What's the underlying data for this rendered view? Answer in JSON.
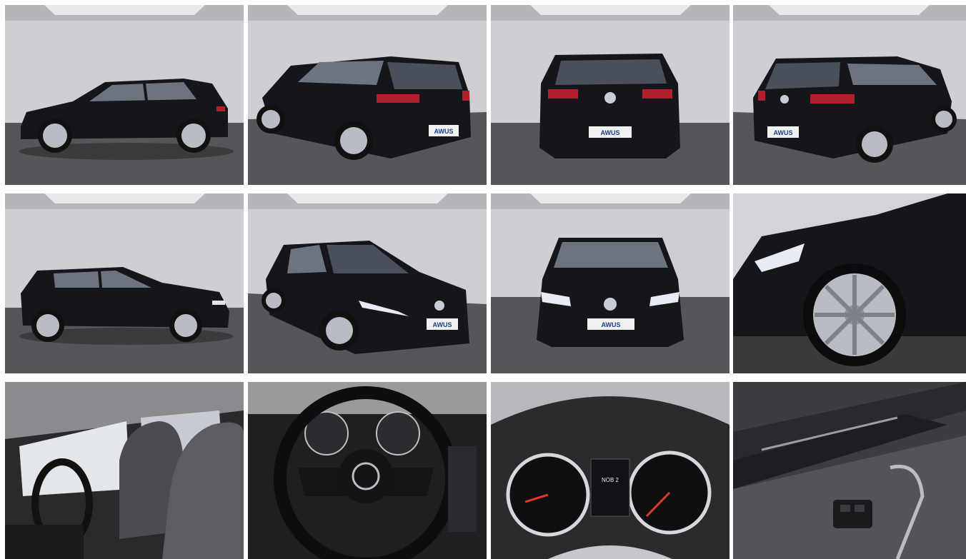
{
  "gallery": {
    "photos": [
      {
        "name": "side-left",
        "plate": "AWUS"
      },
      {
        "name": "rear-left-three-quarter",
        "plate": "AWUS"
      },
      {
        "name": "rear",
        "plate": "AWUS"
      },
      {
        "name": "rear-right-three-quarter",
        "plate": "AWUS"
      },
      {
        "name": "side-right",
        "plate": ""
      },
      {
        "name": "front-left-three-quarter",
        "plate": "AWUS"
      },
      {
        "name": "front",
        "plate": "AWUS"
      },
      {
        "name": "front-wheel-closeup",
        "plate": ""
      },
      {
        "name": "interior-front-seats",
        "plate": ""
      },
      {
        "name": "steering-wheel",
        "plate": ""
      },
      {
        "name": "instrument-cluster",
        "plate": ""
      },
      {
        "name": "door-panel-window-switches",
        "plate": ""
      }
    ],
    "cluster_display_text": "NOB 2"
  },
  "colors": {
    "car_body": "#15161c",
    "studio_wall": "#c9c9cd",
    "studio_floor": "#5a5a5e",
    "tail_light": "#b0202a",
    "wheel": "#b9bcc2"
  }
}
